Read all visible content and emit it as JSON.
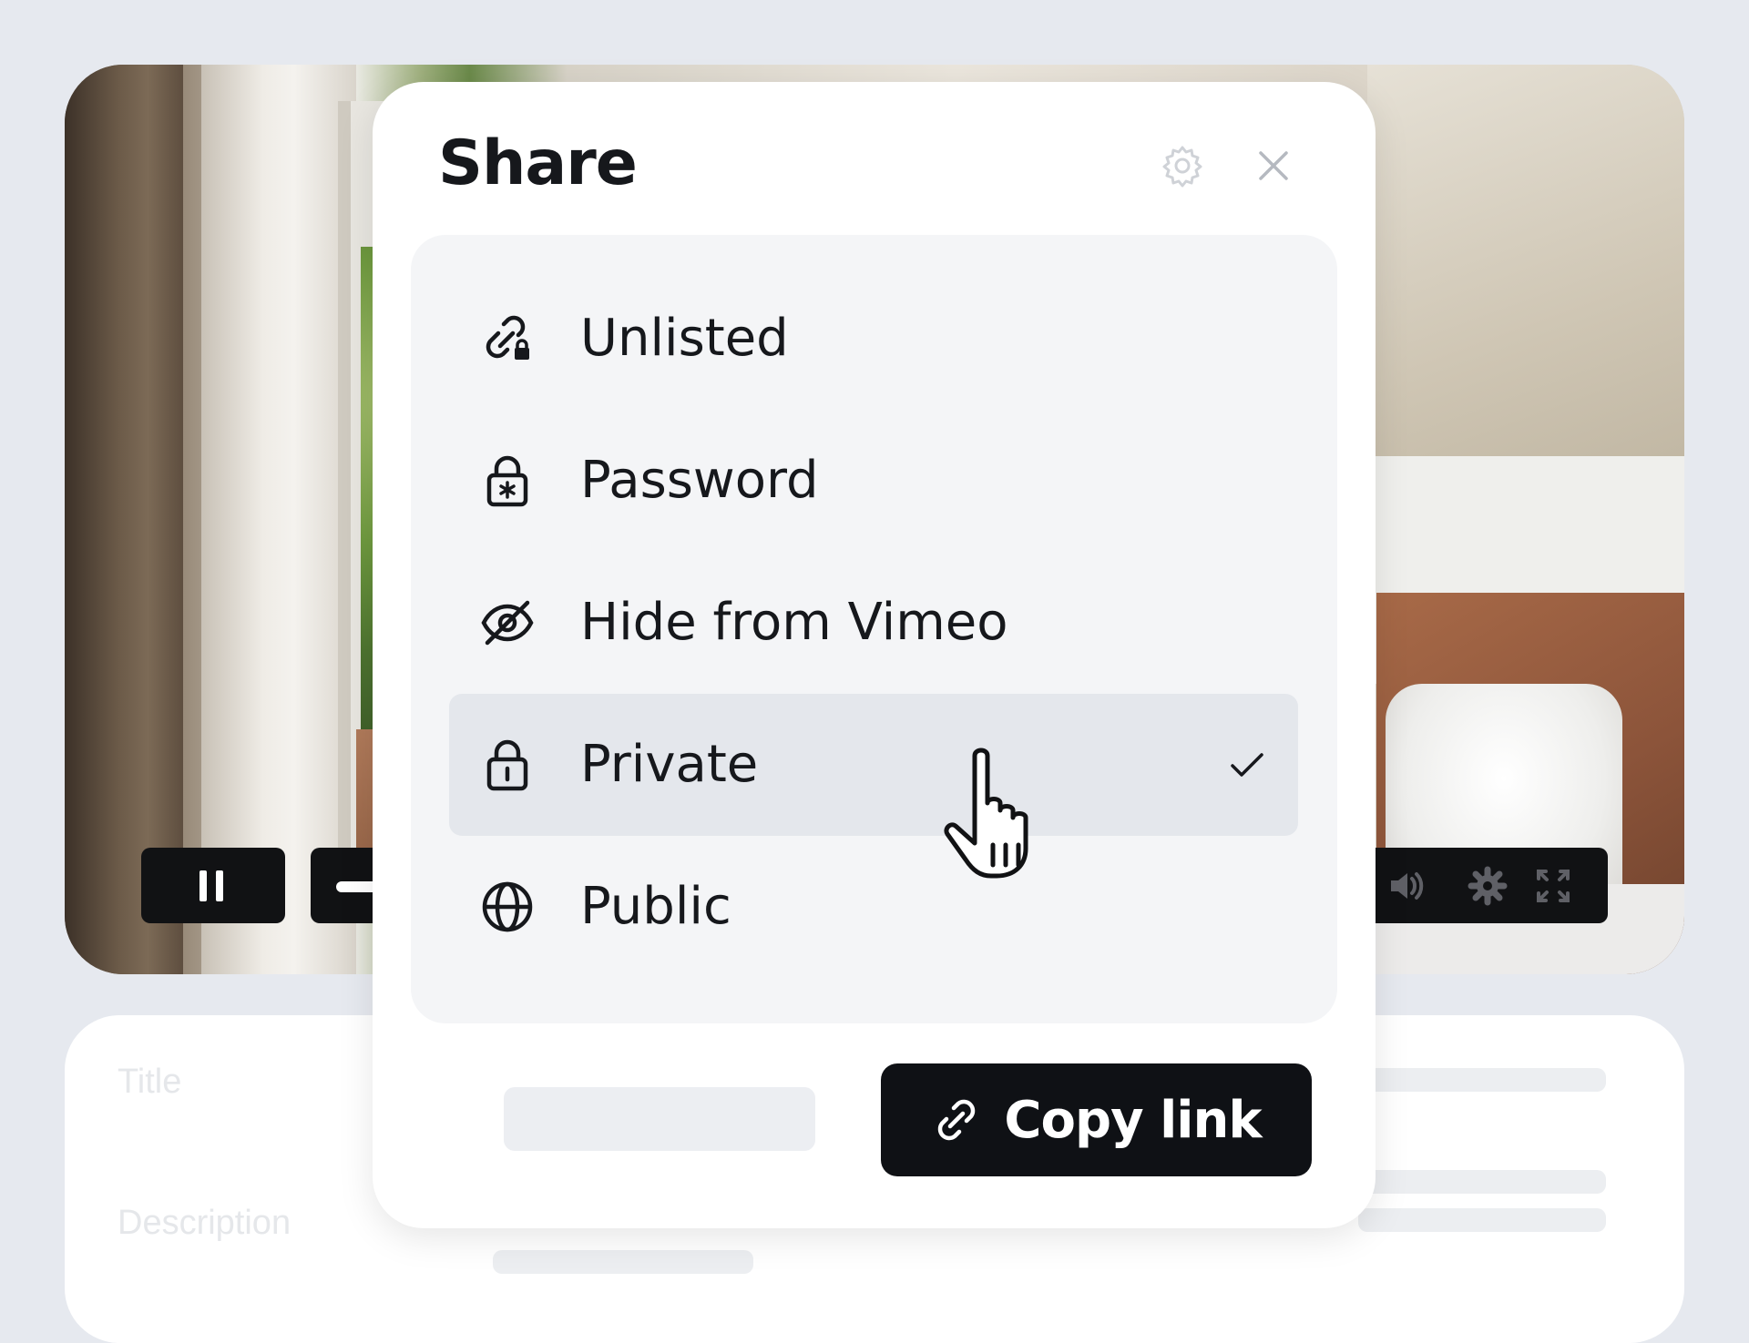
{
  "modal": {
    "title": "Share",
    "settings_icon": "gear-icon",
    "close_icon": "close-icon",
    "options": [
      {
        "label": "Unlisted",
        "icon": "link-lock-icon",
        "selected": false
      },
      {
        "label": "Password",
        "icon": "lock-asterisk-icon",
        "selected": false
      },
      {
        "label": "Hide from Vimeo",
        "icon": "eye-off-icon",
        "selected": false
      },
      {
        "label": "Private",
        "icon": "lock-icon",
        "selected": true
      },
      {
        "label": "Public",
        "icon": "globe-icon",
        "selected": false
      }
    ],
    "copy_link_label": "Copy link",
    "copy_link_icon": "link-icon"
  },
  "video_controls": {
    "pause_icon": "pause-icon",
    "volume_icon": "volume-icon",
    "settings_icon": "gear-icon",
    "fullscreen_icon": "fullscreen-icon"
  },
  "info_card": {
    "title_label": "Title",
    "description_label": "Description"
  },
  "colors": {
    "page_bg": "#e6e9ef",
    "modal_bg": "#ffffff",
    "panel_bg": "#f4f5f7",
    "selected_row_bg": "#e4e7ec",
    "primary_button_bg": "#0f1115",
    "text": "#16181c"
  }
}
